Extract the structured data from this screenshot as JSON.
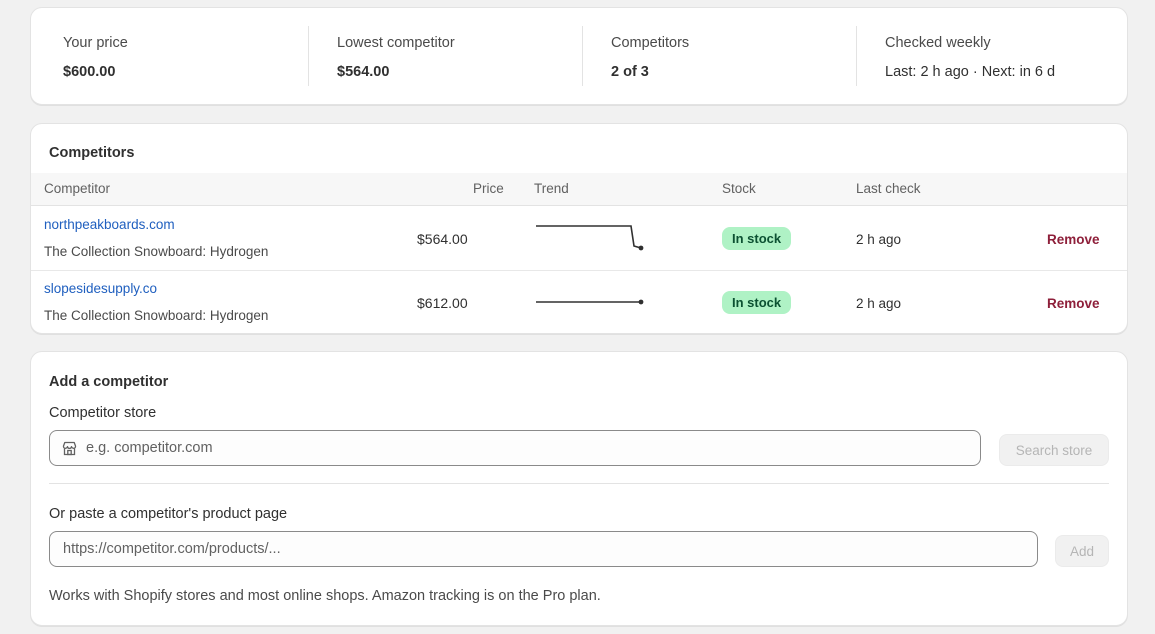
{
  "summary": {
    "your_price_label": "Your price",
    "your_price_value": "$600.00",
    "lowest_label": "Lowest competitor",
    "lowest_value": "$564.00",
    "competitors_label": "Competitors",
    "competitors_value": "2 of 3",
    "checked_label": "Checked weekly",
    "checked_value": "Last: 2 h ago · Next: in 6 d"
  },
  "competitors": {
    "title": "Competitors",
    "headers": {
      "competitor": "Competitor",
      "price": "Price",
      "trend": "Trend",
      "stock": "Stock",
      "last_check": "Last check"
    },
    "rows": [
      {
        "store": "northpeakboards.com",
        "product": "The Collection Snowboard: Hydrogen",
        "price": "$564.00",
        "stock": "In stock",
        "last_check": "2 h ago",
        "action": "Remove"
      },
      {
        "store": "slopesidesupply.co",
        "product": "The Collection Snowboard: Hydrogen",
        "price": "$612.00",
        "stock": "In stock",
        "last_check": "2 h ago",
        "action": "Remove"
      }
    ]
  },
  "add": {
    "title": "Add a competitor",
    "store_label": "Competitor store",
    "store_placeholder": "e.g. competitor.com",
    "search_button": "Search store",
    "page_label": "Or paste a competitor's product page",
    "page_placeholder": "https://competitor.com/products/...",
    "add_button": "Add",
    "help_text": "Works with Shopify stores and most online shops. Amazon tracking is on the Pro plan."
  },
  "colors": {
    "link": "#1f5fbf",
    "badge_bg": "#aff2c5",
    "badge_text": "#0c5132",
    "remove": "#8e1f3a"
  },
  "icons": [
    "store-icon"
  ]
}
